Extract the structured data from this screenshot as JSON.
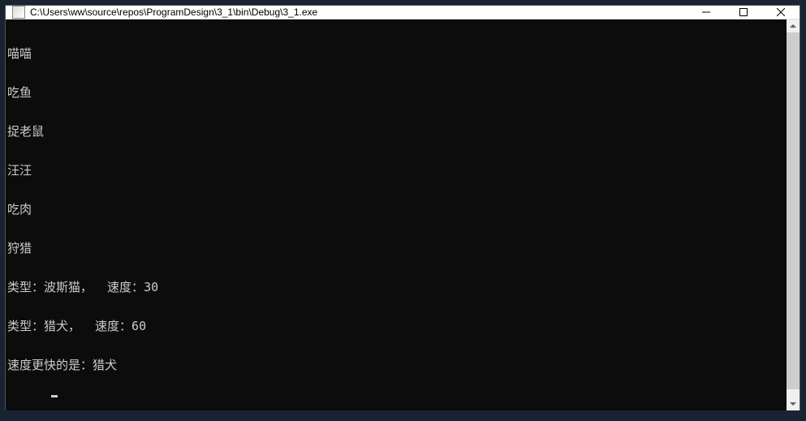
{
  "titlebar": {
    "title": "C:\\Users\\ww\\source\\repos\\ProgramDesign\\3_1\\bin\\Debug\\3_1.exe"
  },
  "console": {
    "lines": [
      "喵喵",
      "吃鱼",
      "捉老鼠",
      "汪汪",
      "吃肉",
      "狩猎",
      "类型：波斯猫，  速度：30",
      "类型：猎犬，  速度：60",
      "速度更快的是：猎犬"
    ]
  }
}
